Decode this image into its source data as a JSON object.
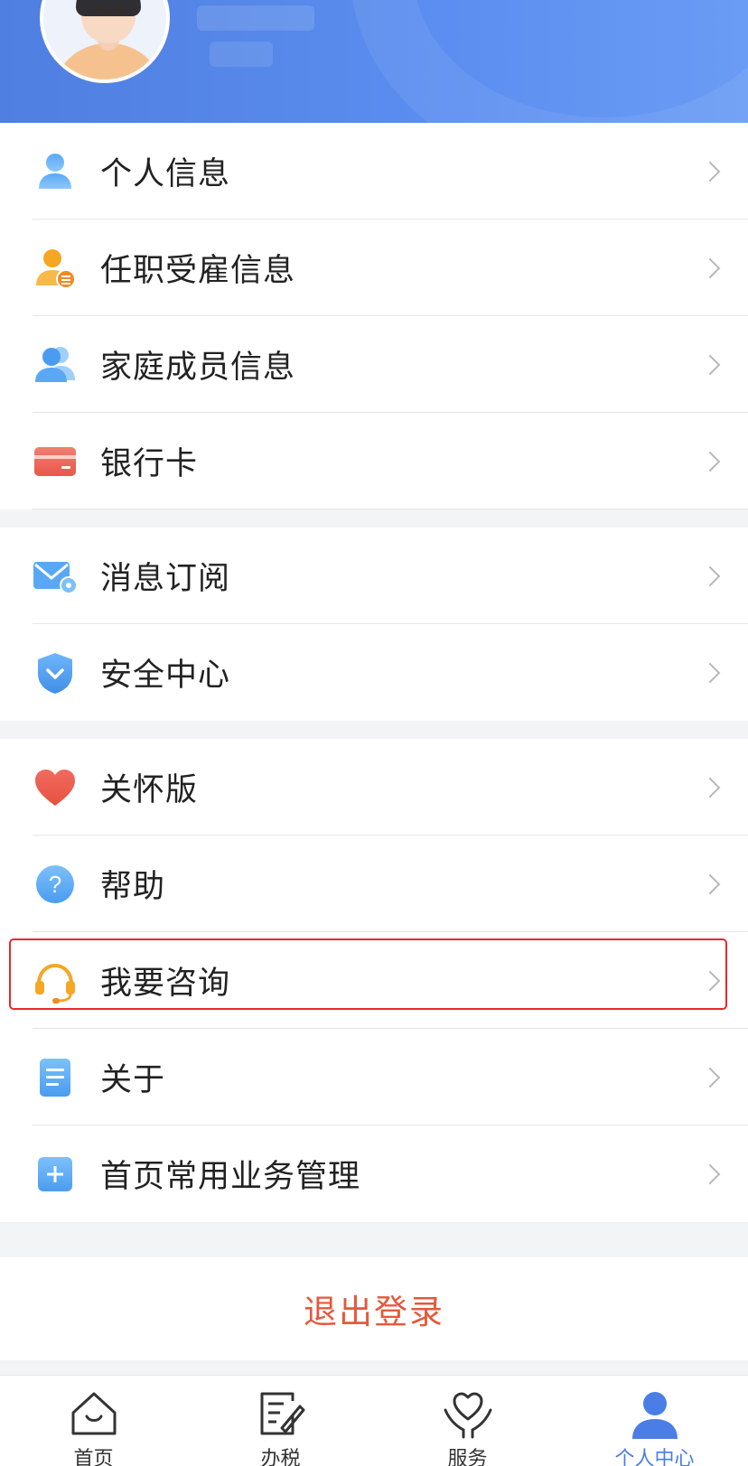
{
  "profile": {
    "avatar_alt": ""
  },
  "menu_group_1": [
    {
      "label": "个人信息",
      "icon": "person-icon"
    },
    {
      "label": "任职受雇信息",
      "icon": "employment-icon"
    },
    {
      "label": "家庭成员信息",
      "icon": "family-icon"
    },
    {
      "label": "银行卡",
      "icon": "bank-card-icon"
    }
  ],
  "menu_group_2": [
    {
      "label": "消息订阅",
      "icon": "mail-settings-icon"
    },
    {
      "label": "安全中心",
      "icon": "shield-icon"
    }
  ],
  "menu_group_3": [
    {
      "label": "关怀版",
      "icon": "heart-icon"
    },
    {
      "label": "帮助",
      "icon": "help-icon"
    },
    {
      "label": "我要咨询",
      "icon": "headset-icon"
    },
    {
      "label": "关于",
      "icon": "document-icon"
    },
    {
      "label": "首页常用业务管理",
      "icon": "plus-square-icon"
    }
  ],
  "logout_label": "退出登录",
  "tabbar": [
    {
      "label": "首页",
      "icon": "home-icon",
      "active": false
    },
    {
      "label": "办税",
      "icon": "tax-edit-icon",
      "active": false
    },
    {
      "label": "服务",
      "icon": "service-heart-icon",
      "active": false
    },
    {
      "label": "个人中心",
      "icon": "user-icon",
      "active": true
    }
  ],
  "colors": {
    "header_blue": "#5b8ef0",
    "logout_red": "#e4593c",
    "active_tab": "#4a7ee6",
    "highlight_red": "#e8282b"
  }
}
